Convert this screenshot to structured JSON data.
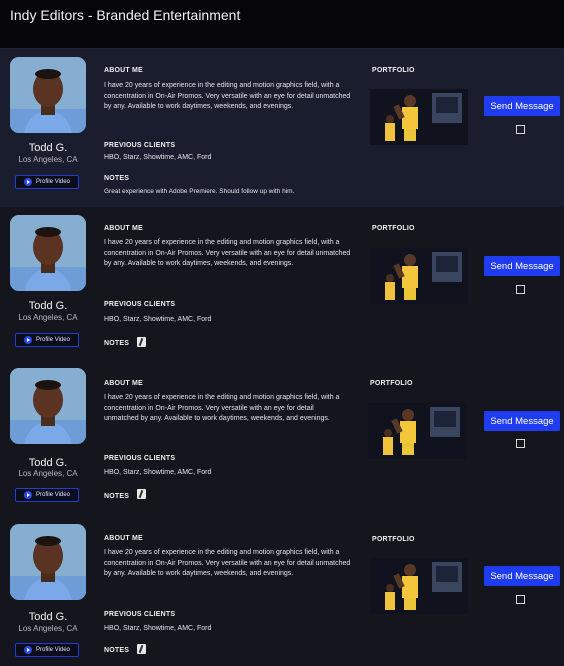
{
  "header": {
    "title": "Indy Editors - Branded Entertainment"
  },
  "labels": {
    "about_me": "ABOUT ME",
    "portfolio": "PORTFOLIO",
    "previous_clients": "PREVIOUS CLIENTS",
    "notes": "NOTES",
    "profile_video": "Profile Video",
    "send_message": "Send Message"
  },
  "editors": [
    {
      "name": "Todd G.",
      "location": "Los Angeles, CA",
      "about": "I have 20 years of experience in the editing and motion graphics field, with a concentration in On-Air Promos.  Very versatile with an eye for detail unmatched by any. Available to work daytimes, weekends, and evenings.",
      "clients": "HBO, Starz, Showtime, AMC, Ford",
      "notes": "Great experience with Adobe Premiere. Should follow up with him.",
      "selected": false
    },
    {
      "name": "Todd G.",
      "location": "Los Angeles, CA",
      "about": "I have 20 years of experience in the editing and motion graphics field, with a concentration in On-Air Promos.  Very versatile with an eye for detail unmatched by any. Available to work daytimes, weekends, and evenings.",
      "clients": "HBO, Starz, Showtime, AMC, Ford",
      "notes": "",
      "selected": false
    },
    {
      "name": "Todd G.",
      "location": "Los Angeles, CA",
      "about": "I have 20 years of experience in the editing and motion graphics field, with a concentration in On-Air Promos.  Very versatile with an eye for detail unmatched by any. Available to work daytimes, weekends, and evenings.",
      "clients": "HBO, Starz, Showtime, AMC, Ford",
      "notes": "",
      "selected": false
    },
    {
      "name": "Todd G.",
      "location": "Los Angeles, CA",
      "about": "I have 20 years of experience in the editing and motion graphics field, with a concentration in On-Air Promos.  Very versatile with an eye for detail unmatched by any. Available to work daytimes, weekends, and evenings.",
      "clients": "HBO, Starz, Showtime, AMC, Ford",
      "notes": "",
      "selected": false
    }
  ],
  "colors": {
    "accent": "#1f3cf0",
    "background": "#111118",
    "highlight_card": "#1a1d2e"
  },
  "icons": {
    "play": "play-icon",
    "notes": "edit-note-icon"
  }
}
